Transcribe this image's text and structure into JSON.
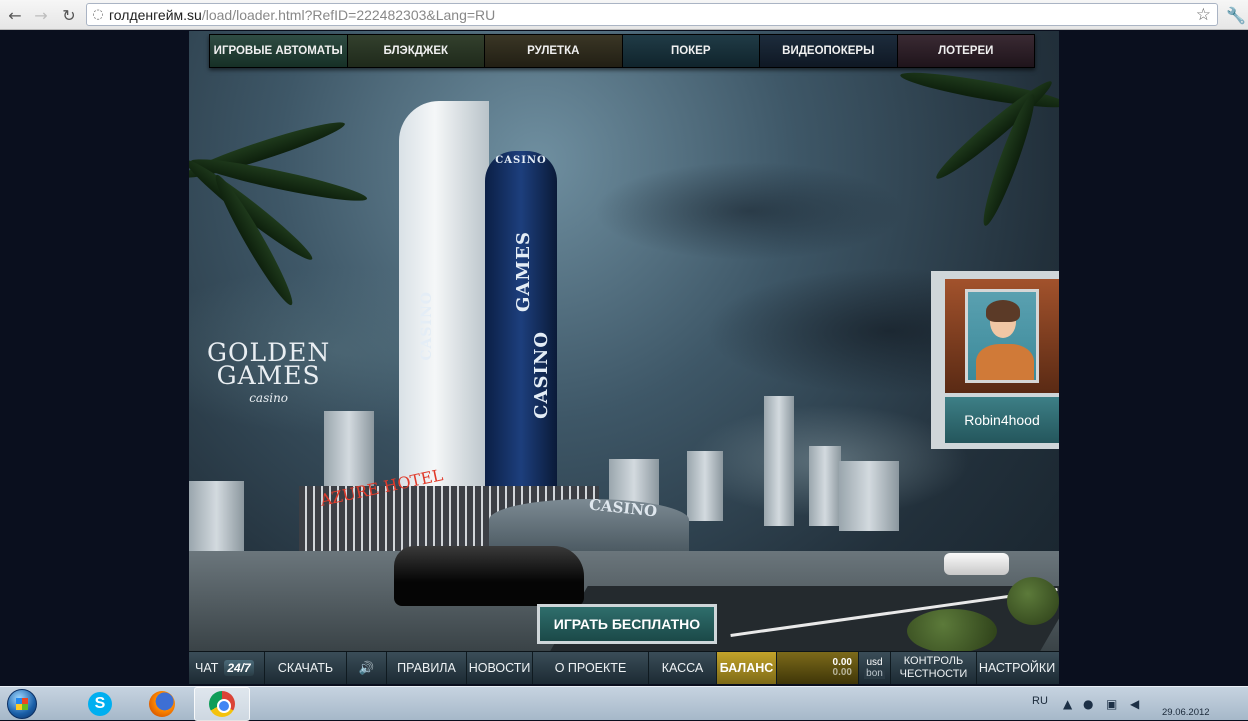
{
  "browser": {
    "url_host": "голденгейм.su",
    "url_path": "/load/loader.html?RefID=222482303&Lang=RU",
    "back_icon": "back-arrow-icon",
    "forward_icon": "forward-arrow-icon",
    "reload_icon": "reload-icon"
  },
  "top_menu": {
    "tabs": [
      {
        "label": "ИГРОВЫЕ АВТОМАТЫ",
        "active": true
      },
      {
        "label": "БЛЭКДЖЕК"
      },
      {
        "label": "РУЛЕТКА"
      },
      {
        "label": "ПОКЕР"
      },
      {
        "label": "ВИДЕОПОКЕРЫ"
      },
      {
        "label": "ЛОТЕРЕИ"
      }
    ]
  },
  "scene": {
    "logo": {
      "line1": "GOLDEN",
      "line2": "GAMES",
      "line3": "casino"
    },
    "tower_sign_white": "CASINO",
    "tower_sign_blue_1": "GAMES",
    "tower_sign_blue_2": "CASINO",
    "tower_sign_top": "CASINO",
    "hotel_sign": "AZURE HOTEL",
    "entrance_sign": "CASINO"
  },
  "profile": {
    "username": "Robin4hood"
  },
  "play_free": {
    "label": "ИГРАТЬ БЕСПЛАТНО"
  },
  "bottom_bar": {
    "chat": "ЧАТ",
    "chat_badge": "24/7",
    "download": "СКАЧАТЬ",
    "rules": "ПРАВИЛА",
    "news": "НОВОСТИ",
    "about": "О ПРОЕКТЕ",
    "cashier": "КАССА",
    "balance": "БАЛАНС",
    "balance_value_1": "0.00",
    "balance_value_2": "0.00",
    "currency_1": "usd",
    "currency_2": "bon",
    "fairness_line1": "КОНТРОЛЬ",
    "fairness_line2": "ЧЕСТНОСТИ",
    "settings": "НАСТРОЙКИ"
  },
  "taskbar": {
    "language": "RU",
    "date": "29.06.2012"
  }
}
